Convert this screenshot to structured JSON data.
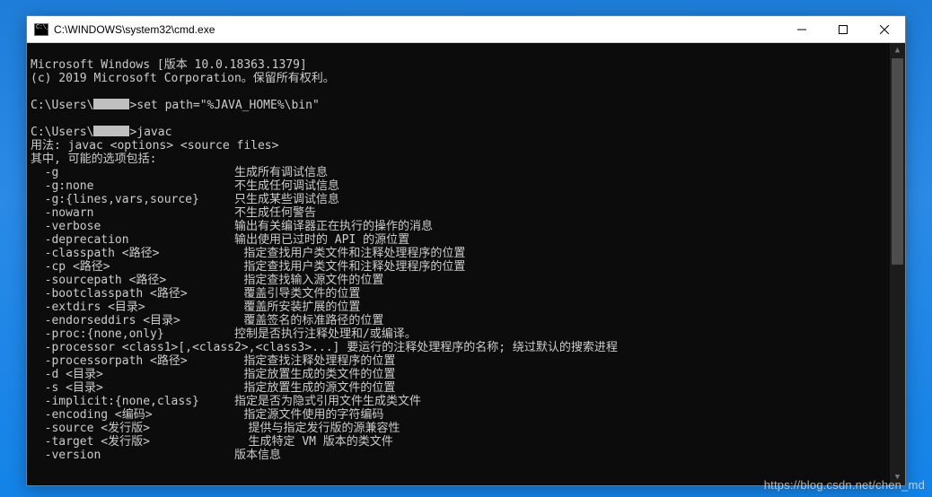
{
  "window": {
    "title": "C:\\WINDOWS\\system32\\cmd.exe"
  },
  "terminal": {
    "banner1": "Microsoft Windows [版本 10.0.18363.1379]",
    "banner2": "(c) 2019 Microsoft Corporation。保留所有权利。",
    "prompt1_prefix": "C:\\Users\\",
    "prompt1_suffix": ">set path=\"%JAVA_HOME%\\bin\"",
    "prompt2_prefix": "C:\\Users\\",
    "prompt2_suffix": ">javac",
    "usage": "用法: javac <options> <source files>",
    "options_intro": "其中, 可能的选项包括:",
    "options": [
      {
        "flag": "  -g                         ",
        "desc": "生成所有调试信息"
      },
      {
        "flag": "  -g:none                    ",
        "desc": "不生成任何调试信息"
      },
      {
        "flag": "  -g:{lines,vars,source}     ",
        "desc": "只生成某些调试信息"
      },
      {
        "flag": "  -nowarn                    ",
        "desc": "不生成任何警告"
      },
      {
        "flag": "  -verbose                   ",
        "desc": "输出有关编译器正在执行的操作的消息"
      },
      {
        "flag": "  -deprecation               ",
        "desc": "输出使用已过时的 API 的源位置"
      },
      {
        "flag": "  -classpath <路径>            ",
        "desc": "指定查找用户类文件和注释处理程序的位置"
      },
      {
        "flag": "  -cp <路径>                   ",
        "desc": "指定查找用户类文件和注释处理程序的位置"
      },
      {
        "flag": "  -sourcepath <路径>           ",
        "desc": "指定查找输入源文件的位置"
      },
      {
        "flag": "  -bootclasspath <路径>        ",
        "desc": "覆盖引导类文件的位置"
      },
      {
        "flag": "  -extdirs <目录>              ",
        "desc": "覆盖所安装扩展的位置"
      },
      {
        "flag": "  -endorseddirs <目录>         ",
        "desc": "覆盖签名的标准路径的位置"
      },
      {
        "flag": "  -proc:{none,only}          ",
        "desc": "控制是否执行注释处理和/或编译。"
      },
      {
        "flag": "  -processor <class1>[,<class2>,<class3>...] ",
        "desc": "要运行的注释处理程序的名称; 绕过默认的搜索进程"
      },
      {
        "flag": "  -processorpath <路径>        ",
        "desc": "指定查找注释处理程序的位置"
      },
      {
        "flag": "  -d <目录>                    ",
        "desc": "指定放置生成的类文件的位置"
      },
      {
        "flag": "  -s <目录>                    ",
        "desc": "指定放置生成的源文件的位置"
      },
      {
        "flag": "  -implicit:{none,class}     ",
        "desc": "指定是否为隐式引用文件生成类文件"
      },
      {
        "flag": "  -encoding <编码>             ",
        "desc": "指定源文件使用的字符编码"
      },
      {
        "flag": "  -source <发行版>              ",
        "desc": "提供与指定发行版的源兼容性"
      },
      {
        "flag": "  -target <发行版>              ",
        "desc": "生成特定 VM 版本的类文件"
      },
      {
        "flag": "  -version                   ",
        "desc": "版本信息"
      }
    ]
  },
  "watermark": "https://blog.csdn.net/chen_md"
}
